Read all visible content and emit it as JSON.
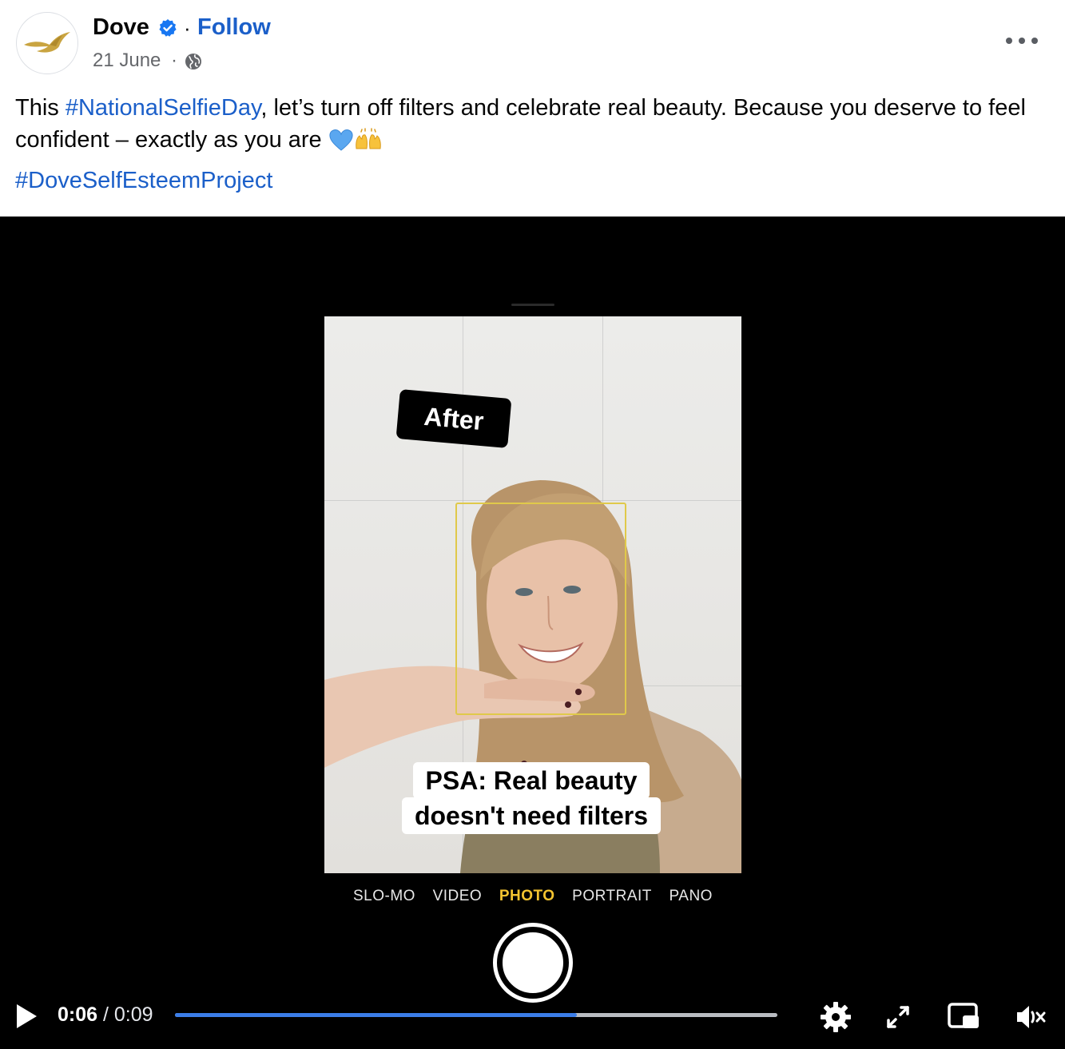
{
  "post": {
    "page_name": "Dove",
    "separator": "·",
    "follow_label": "Follow",
    "date": "21 June",
    "date_separator": "·",
    "caption_start": "This ",
    "caption_hashtag": "#NationalSelfieDay",
    "caption_rest": ", let’s turn off filters and celebrate real beauty. Because you deserve to feel confident – exactly as you are ",
    "emoji_heart": "💙",
    "emoji_hands": "🙌",
    "hashtag_line": "#DoveSelfEsteemProject"
  },
  "video": {
    "after_label": "After",
    "psa_line1": "PSA: Real beauty",
    "psa_line2": "doesn't need filters",
    "camera_modes": [
      "SLO-MO",
      "VIDEO",
      "PHOTO",
      "PORTRAIT",
      "PANO"
    ],
    "active_mode": "PHOTO",
    "current_time": "0:06",
    "time_separator": " / ",
    "total_time": "0:09",
    "progress_fraction": 0.667
  },
  "colors": {
    "link_blue": "#1b5fc9",
    "progress_fill": "#3b7de8",
    "active_mode": "#f4c430",
    "brand_gold": "#c9a441"
  },
  "icons": [
    "verified-badge-icon",
    "globe-icon",
    "more-options-icon",
    "play-icon",
    "settings-gear-icon",
    "fullscreen-icon",
    "picture-in-picture-icon",
    "volume-muted-icon"
  ]
}
